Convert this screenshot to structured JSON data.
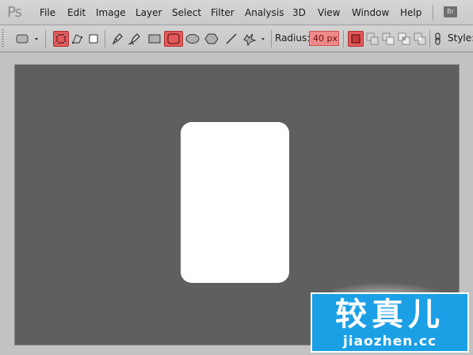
{
  "app": {
    "logo_text": "Ps"
  },
  "menu": [
    "File",
    "Edit",
    "Image",
    "Layer",
    "Select",
    "Filter",
    "Analysis",
    "3D",
    "View",
    "Window",
    "Help"
  ],
  "bridge_button": "Br",
  "options": {
    "radius_label": "Radius:",
    "radius_value": "40 px",
    "style_label": "Style:"
  },
  "colors": {
    "active_tool": "#e35a5a",
    "canvas": "#5f5f5f",
    "shape_fill": "#ffffff"
  },
  "watermark": {
    "text_cn": "较真儿",
    "url": "jiaozhen.cc"
  }
}
